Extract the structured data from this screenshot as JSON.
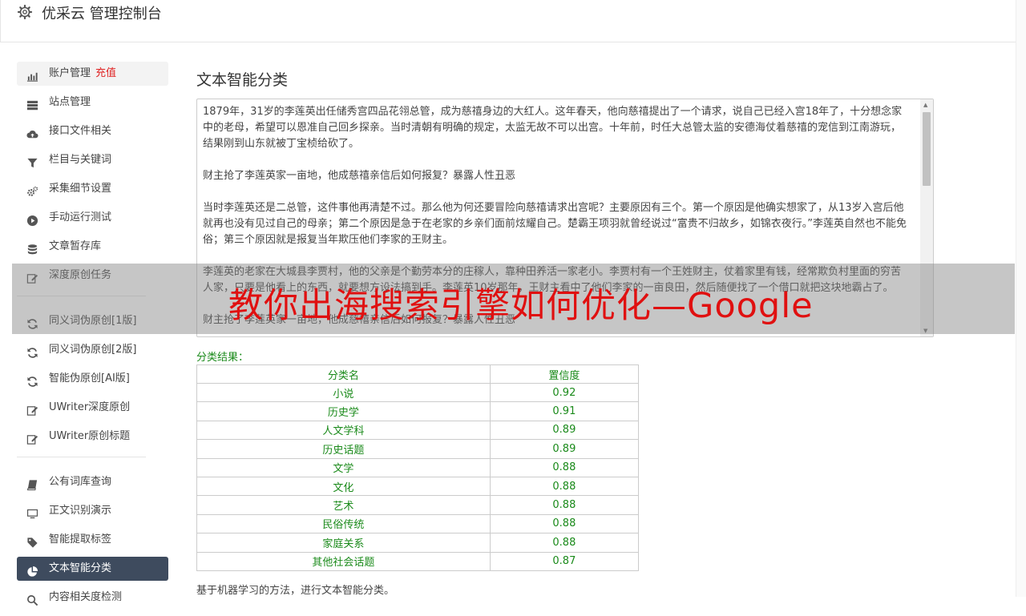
{
  "header": {
    "title": "优采云 管理控制台"
  },
  "sidebar": {
    "groups": [
      [
        {
          "label": "账户管理",
          "extra": "充值",
          "icon": "bar-chart-icon",
          "state": "hover"
        },
        {
          "label": "站点管理",
          "icon": "server-icon"
        },
        {
          "label": "接口文件相关",
          "icon": "cloud-upload-icon"
        },
        {
          "label": "栏目与关键词",
          "icon": "filter-icon"
        },
        {
          "label": "采集细节设置",
          "icon": "gears-icon"
        },
        {
          "label": "手动运行测试",
          "icon": "play-circle-icon"
        },
        {
          "label": "文章暂存库",
          "icon": "database-icon"
        },
        {
          "label": "深度原创任务",
          "icon": "edit-icon"
        }
      ],
      [
        {
          "label": "同义词伪原创[1版]",
          "icon": "refresh-icon"
        },
        {
          "label": "同义词伪原创[2版]",
          "icon": "refresh-icon"
        },
        {
          "label": "智能伪原创[AI版]",
          "icon": "refresh-icon"
        },
        {
          "label": "UWriter深度原创",
          "icon": "edit-icon"
        },
        {
          "label": "UWriter原创标题",
          "icon": "edit-icon"
        }
      ],
      [
        {
          "label": "公有词库查询",
          "icon": "book-icon"
        },
        {
          "label": "正文识别演示",
          "icon": "monitor-icon"
        },
        {
          "label": "智能提取标签",
          "icon": "tag-icon"
        },
        {
          "label": "文本智能分类",
          "icon": "pie-chart-icon",
          "state": "active"
        },
        {
          "label": "内容相关度检测",
          "icon": "search-icon"
        }
      ]
    ]
  },
  "main": {
    "title": "文本智能分类",
    "text_paragraphs": [
      "1879年，31岁的李莲英出任储秀宫四品花翎总管，成为慈禧身边的大红人。这年春天，他向慈禧提出了一个请求，说自己已经入宫18年了，十分想念家中的老母，希望可以恩准自己回乡探亲。当时清朝有明确的规定，太监无故不可以出宫。十年前，时任大总管太监的安德海仗着慈禧的宠信到江南游玩，结果刚到山东就被丁宝桢给砍了。",
      "财主抢了李莲英家一亩地，他成慈禧亲信后如何报复？暴露人性丑恶",
      "当时李莲英还是二总管，这件事他再清楚不过。那么他为何还要冒险向慈禧请求出宫呢？主要原因有三个。第一个原因是他确实想家了，从13岁入宫后他就再也没有见过自己的母亲；第二个原因是急于在老家的乡亲们面前炫耀自己。楚霸王项羽就曾经说过“富贵不归故乡，如锦衣夜行。”李莲英自然也不能免俗；第三个原因就是报复当年欺压他们李家的王财主。",
      "李莲英的老家在大城县李贾村，他的父亲是个勤劳本分的庄稼人，靠种田养活一家老小。李贾村有一个王姓财主，仗着家里有钱，经常欺负村里面的穷苦人家，只要是他看上的东西，就要想方设法搞到手。李莲英10岁那年，王财主看中了他们李家的一亩良田，然后随便找了一个借口就把这块地霸占了。",
      "财主抢了李莲英家一亩地，他成慈禧亲信后如何报复？暴露人性丑恶"
    ],
    "result_label": "分类结果：",
    "table": {
      "headers": [
        "分类名",
        "置信度"
      ],
      "rows": [
        [
          "小说",
          "0.92"
        ],
        [
          "历史学",
          "0.91"
        ],
        [
          "人文学科",
          "0.89"
        ],
        [
          "历史话题",
          "0.89"
        ],
        [
          "文学",
          "0.88"
        ],
        [
          "文化",
          "0.88"
        ],
        [
          "艺术",
          "0.88"
        ],
        [
          "民俗传统",
          "0.88"
        ],
        [
          "家庭关系",
          "0.88"
        ],
        [
          "其他社会话题",
          "0.87"
        ]
      ]
    },
    "footer_note": "基于机器学习的方法，进行文本智能分类。"
  },
  "overlay": {
    "text": "教你出海搜索引擎如何优化—Google"
  },
  "colors": {
    "active_nav_bg": "#3e4b5e",
    "result_green": "#1a8a1a",
    "recharge_red": "#e02424"
  }
}
